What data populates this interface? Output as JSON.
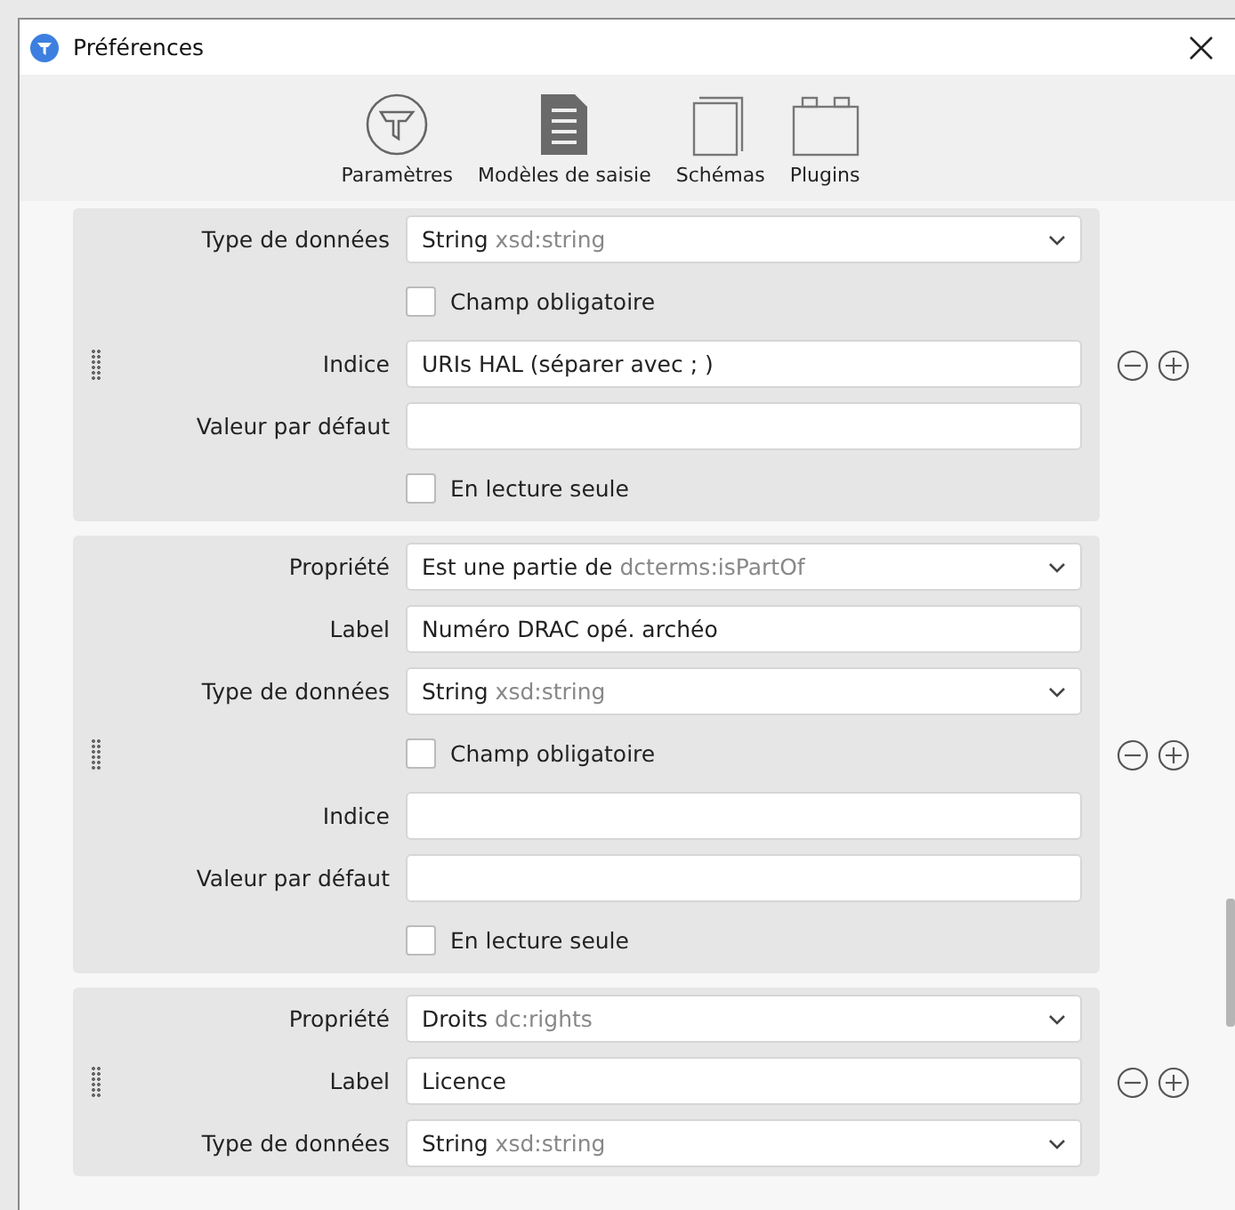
{
  "window": {
    "title": "Préférences"
  },
  "toolbar": [
    {
      "label": "Paramètres",
      "kind": "settings"
    },
    {
      "label": "Modèles de saisie",
      "kind": "templates"
    },
    {
      "label": "Schémas",
      "kind": "schemas"
    },
    {
      "label": "Plugins",
      "kind": "plugins"
    }
  ],
  "cards": [
    {
      "fields": [
        {
          "kind": "select",
          "label": "Type de données",
          "value": "String",
          "hint": "xsd:string"
        },
        {
          "kind": "checkbox",
          "label": "Champ obligatoire",
          "checked": false
        },
        {
          "kind": "text",
          "label": "Indice",
          "value": "URIs HAL (séparer avec ; )"
        },
        {
          "kind": "text",
          "label": "Valeur par défaut"
        },
        {
          "kind": "checkbox",
          "label": "En lecture seule",
          "checked": false
        }
      ]
    },
    {
      "fields": [
        {
          "kind": "select",
          "label": "Propriété",
          "value": "Est une partie de",
          "hint": "dcterms:isPartOf"
        },
        {
          "kind": "text",
          "label": "Label",
          "value": "Numéro DRAC opé. archéo"
        },
        {
          "kind": "select",
          "label": "Type de données",
          "value": "String",
          "hint": "xsd:string"
        },
        {
          "kind": "checkbox",
          "label": "Champ obligatoire",
          "checked": false
        },
        {
          "kind": "text",
          "label": "Indice"
        },
        {
          "kind": "text",
          "label": "Valeur par défaut"
        },
        {
          "kind": "checkbox",
          "label": "En lecture seule",
          "checked": false
        }
      ]
    },
    {
      "fields": [
        {
          "kind": "select",
          "label": "Propriété",
          "value": "Droits",
          "hint": "dc:rights"
        },
        {
          "kind": "text",
          "label": "Label",
          "value": "Licence"
        },
        {
          "kind": "select",
          "label": "Type de données",
          "value": "String",
          "hint": "xsd:string"
        }
      ]
    }
  ]
}
